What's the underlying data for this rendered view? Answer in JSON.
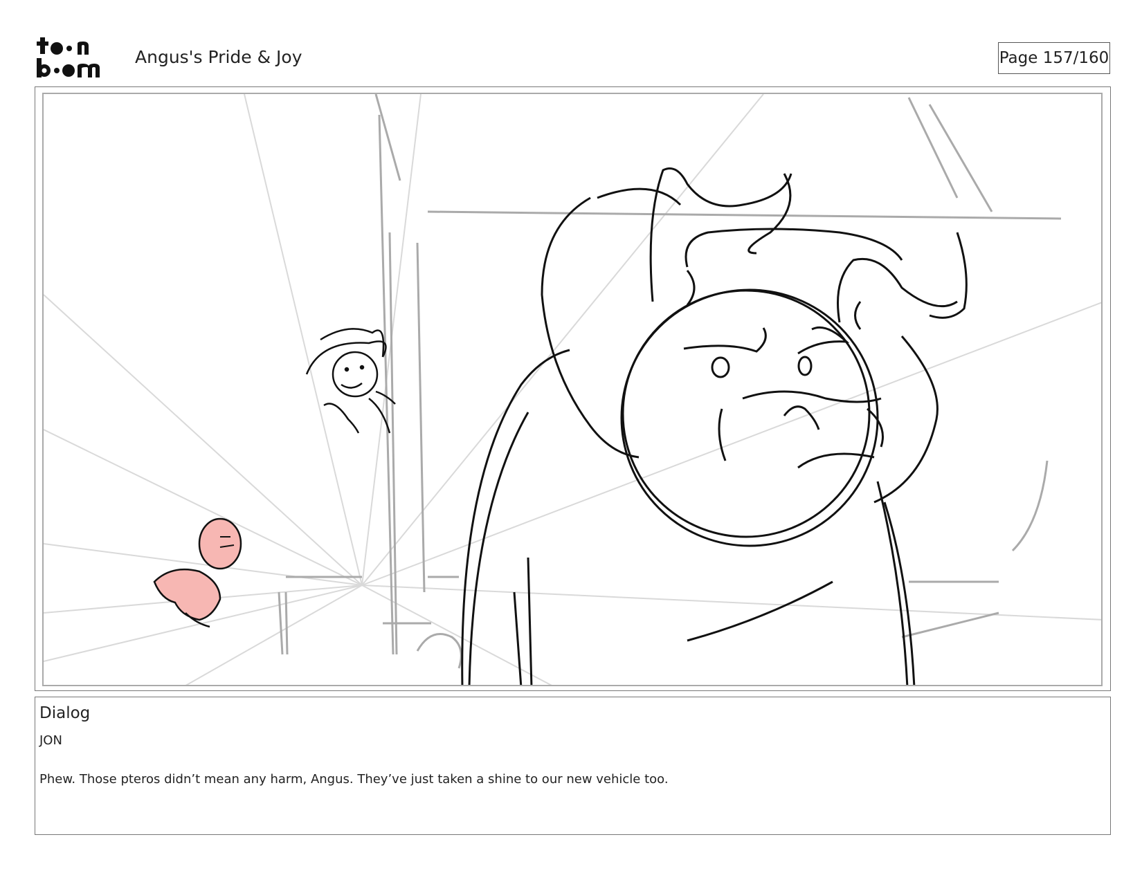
{
  "header": {
    "logo_top": "to•n",
    "logo_bottom": "b••m",
    "project_title": "Angus's Pride & Joy",
    "page_label": "Page 157/160"
  },
  "panel": {
    "tint_color": "#f7b7b3",
    "line_color": "#111111"
  },
  "dialog": {
    "heading": "Dialog",
    "speaker": "JON",
    "line": "Phew. Those pteros didn’t mean any harm, Angus. They’ve just taken a shine to our new vehicle too."
  }
}
